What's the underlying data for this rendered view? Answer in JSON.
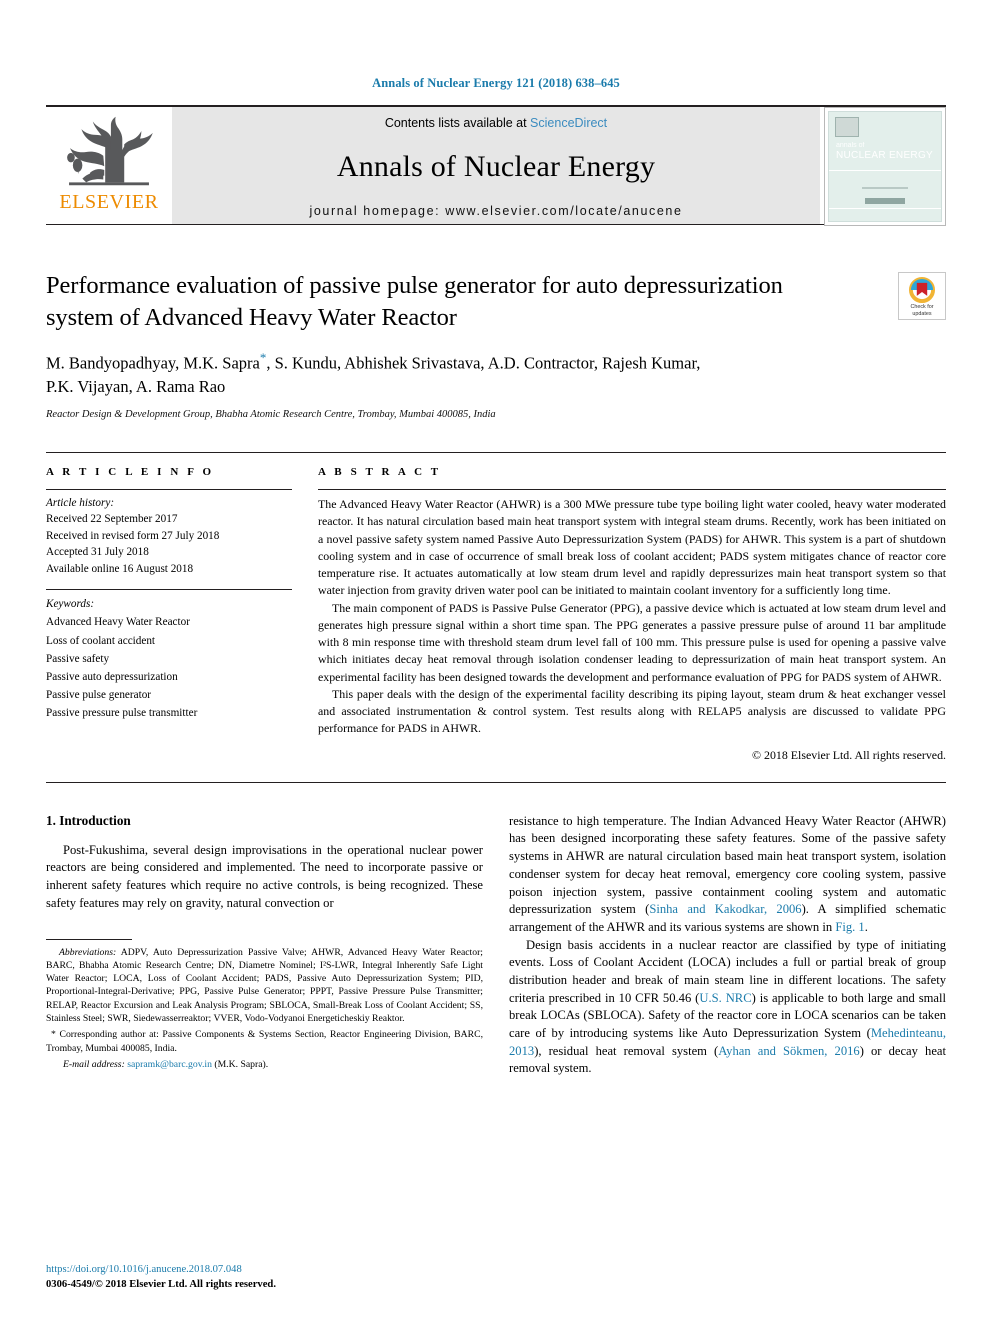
{
  "running_head": "Annals of Nuclear Energy 121 (2018) 638–645",
  "masthead": {
    "publisher_name": "ELSEVIER",
    "publisher_logo_icon": "elsevier-tree-icon",
    "contents_prefix": "Contents lists available at ",
    "contents_link": "ScienceDirect",
    "journal_name": "Annals of Nuclear Energy",
    "homepage": "journal homepage: www.elsevier.com/locate/anucene",
    "cover": {
      "line1": "annals of",
      "line2": "NUCLEAR ENERGY"
    }
  },
  "article": {
    "title": "Performance evaluation of passive pulse generator for auto depressurization system of Advanced Heavy Water Reactor",
    "authors_line1_a": "M. Bandyopadhyay, M.K. Sapra",
    "authors_star": "*",
    "authors_line1_b": ", S. Kundu, Abhishek Srivastava, A.D. Contractor, Rajesh Kumar,",
    "authors_line2": "P.K. Vijayan, A. Rama Rao",
    "affiliation": "Reactor Design & Development Group, Bhabha Atomic Research Centre, Trombay, Mumbai 400085, India",
    "crossmark_label_line1": "Check for",
    "crossmark_label_line2": "updates"
  },
  "article_info": {
    "heading": "A R T I C L E   I N F O",
    "history_label": "Article history:",
    "history": [
      "Received 22 September 2017",
      "Received in revised form 27 July 2018",
      "Accepted 31 July 2018",
      "Available online 16 August 2018"
    ],
    "keywords_label": "Keywords:",
    "keywords": [
      "Advanced Heavy Water Reactor",
      "Loss of coolant accident",
      "Passive safety",
      "Passive auto depressurization",
      "Passive pulse generator",
      "Passive pressure pulse transmitter"
    ]
  },
  "abstract": {
    "heading": "A B S T R A C T",
    "paragraphs": [
      "The Advanced Heavy Water Reactor (AHWR) is a 300 MWe pressure tube type boiling light water cooled, heavy water moderated reactor. It has natural circulation based main heat transport system with integral steam drums. Recently, work has been initiated on a novel passive safety system named Passive Auto Depressurization System (PADS) for AHWR. This system is a part of shutdown cooling system and in case of occurrence of small break loss of coolant accident; PADS system mitigates chance of reactor core temperature rise. It actuates automatically at low steam drum level and rapidly depressurizes main heat transport system so that water injection from gravity driven water pool can be initiated to maintain coolant inventory for a sufficiently long time.",
      "The main component of PADS is Passive Pulse Generator (PPG), a passive device which is actuated at low steam drum level and generates high pressure signal within a short time span. The PPG generates a passive pressure pulse of around 11 bar amplitude with 8 min response time with threshold steam drum level fall of 100 mm. This pressure pulse is used for opening a passive valve which initiates decay heat removal through isolation condenser leading to depressurization of main heat transport system. An experimental facility has been designed towards the development and performance evaluation of PPG for PADS system of AHWR.",
      "This paper deals with the design of the experimental facility describing its piping layout, steam drum & heat exchanger vessel and associated instrumentation & control system. Test results along with RELAP5 analysis are discussed to validate PPG performance for PADS in AHWR."
    ],
    "copyright": "© 2018 Elsevier Ltd. All rights reserved."
  },
  "introduction": {
    "heading": "1. Introduction",
    "left_paragraph": "Post-Fukushima, several design improvisations in the operational nuclear power reactors are being considered and implemented. The need to incorporate passive or inherent safety features which require no active controls, is being recognized. These safety features may rely on gravity, natural convection or",
    "right_p1_a": "resistance to high temperature. The Indian Advanced Heavy Water Reactor (AHWR) has been designed incorporating these safety features. Some of the passive safety systems in AHWR are natural circulation based main heat transport system, isolation condenser system for decay heat removal, emergency core cooling system, passive poison injection system, passive containment cooling system and automatic depressurization system (",
    "right_p1_cite1": "Sinha and Kakodkar, 2006",
    "right_p1_b": "). A simplified schematic arrangement of the AHWR and its various systems are shown in ",
    "right_p1_figref": "Fig. 1",
    "right_p1_c": ".",
    "right_p2_a": "Design basis accidents in a nuclear reactor are classified by type of initiating events. Loss of Coolant Accident (LOCA) includes a full or partial break of group distribution header and break of main steam line in different locations. The safety criteria prescribed in 10 CFR 50.46 (",
    "right_p2_cite1": "U.S. NRC",
    "right_p2_b": ") is applicable to both large and small break LOCAs (SBLOCA). Safety of the reactor core in LOCA scenarios can be taken care of by introducing systems like Auto Depressurization System (",
    "right_p2_cite2": "Mehedinteanu, 2013",
    "right_p2_c": "), residual heat removal system (",
    "right_p2_cite3": "Ayhan and Sökmen, 2016",
    "right_p2_d": ") or decay heat removal system."
  },
  "footnotes": {
    "abbrev_label": "Abbreviations:",
    "abbrev_text": " ADPV, Auto Depressurization Passive Valve; AHWR, Advanced Heavy Water Reactor; BARC, Bhabha Atomic Research Centre; DN, Diametre Nominel; I²S-LWR, Integral Inherently Safe Light Water Reactor; LOCA, Loss of Coolant Accident; PADS, Passive Auto Depressurization System; PID, Proportional-Integral-Derivative; PPG, Passive Pulse Generator; PPPT, Passive Pressure Pulse Transmitter; RELAP, Reactor Excursion and Leak Analysis Program; SBLOCA, Small-Break Loss of Coolant Accident; SS, Stainless Steel; SWR, Siedewasserreaktor; VVER, Vodo-Vodyanoi Energeticheskiy Reaktor.",
    "corresponding": "* Corresponding author at: Passive Components & Systems Section, Reactor Engineering Division, BARC, Trombay, Mumbai 400085, India.",
    "email_label": "E-mail address:",
    "email": "sapramk@barc.gov.in",
    "email_suffix": " (M.K. Sapra)."
  },
  "page_footer": {
    "doi": "https://doi.org/10.1016/j.anucene.2018.07.048",
    "issn_line": "0306-4549/© 2018 Elsevier Ltd. All rights reserved."
  },
  "colors": {
    "link": "#1a7bab",
    "elsevier_orange": "#ED8B00",
    "masthead_grey": "#e6e6e6"
  }
}
